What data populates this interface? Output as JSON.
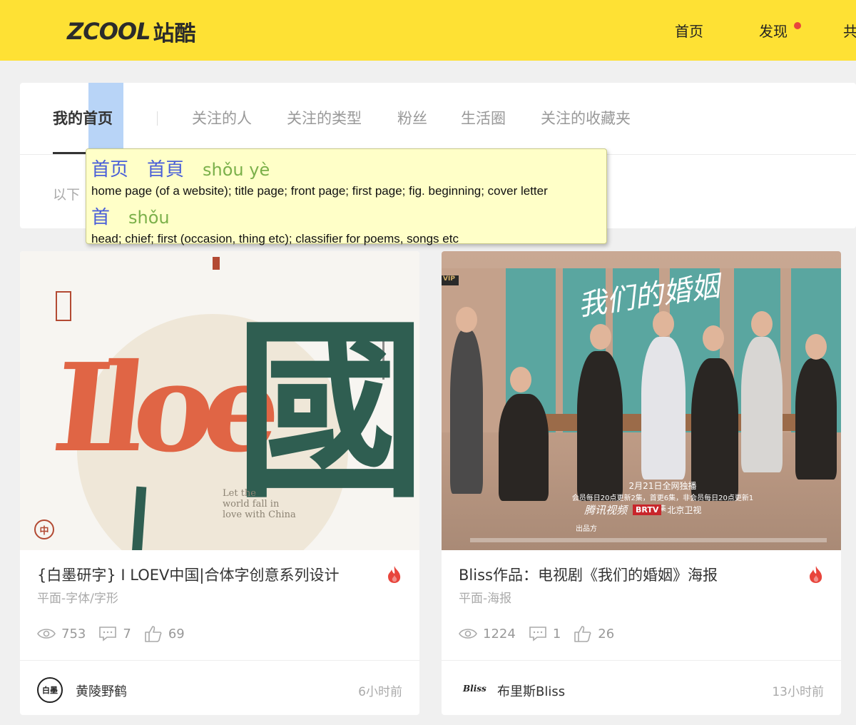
{
  "header": {
    "logo_word": "ZCOOL",
    "logo_cn": "站酷",
    "nav": [
      "首页",
      "发现",
      "共"
    ]
  },
  "tabs": {
    "items": [
      "我的首页",
      "关注的人",
      "关注的类型",
      "粉丝",
      "生活圈",
      "关注的收藏夹"
    ],
    "subtext": "以下"
  },
  "dictionary": {
    "entries": [
      {
        "hanzi": [
          "首页",
          "首頁"
        ],
        "pinyin": "shǒu yè",
        "definition": "home page (of a website); title page; front page; first page; fig. beginning; cover letter"
      },
      {
        "hanzi": [
          "首"
        ],
        "pinyin": "shǒu",
        "definition": "head; chief; first (occasion, thing etc); classifier for poems, songs etc"
      }
    ]
  },
  "cards": [
    {
      "title": "{白墨研字} I LOEV中国|合体字创意系列设计",
      "category": "平面-字体/字形",
      "views": "753",
      "comments": "7",
      "likes": "69",
      "author": "黄陵野鹤",
      "avatar_text": "白墨",
      "time": "6小时前",
      "art": {
        "love_text": "Iloe",
        "guo_char": "國",
        "tagline": "Let the\nworld fall in\nlove with China",
        "seal": "中"
      }
    },
    {
      "title": "Bliss作品：电视剧《我们的婚姻》海报",
      "category": "平面-海报",
      "views": "1224",
      "comments": "1",
      "likes": "26",
      "author": "布里斯Bliss",
      "avatar_text": "Bliss",
      "time": "13小时前",
      "art": {
        "script_title": "我们的婚姻",
        "vip": "VIP",
        "credits_line1": "2月21日全网独播",
        "credits_line2": "会员每日20点更新2集，首更6集，非会员每日20点更新1集",
        "platform": "腾讯视频",
        "brtv": "BRTV",
        "brtv_name": "北京卫视",
        "producer": "出品方"
      }
    }
  ],
  "colors": {
    "header_bg": "#fee134",
    "highlight": "#b8d4f7",
    "popup_bg": "#ffffc8",
    "hanzi": "#4a5fd8",
    "pinyin": "#7bb04a",
    "fire": "#e8453c"
  }
}
